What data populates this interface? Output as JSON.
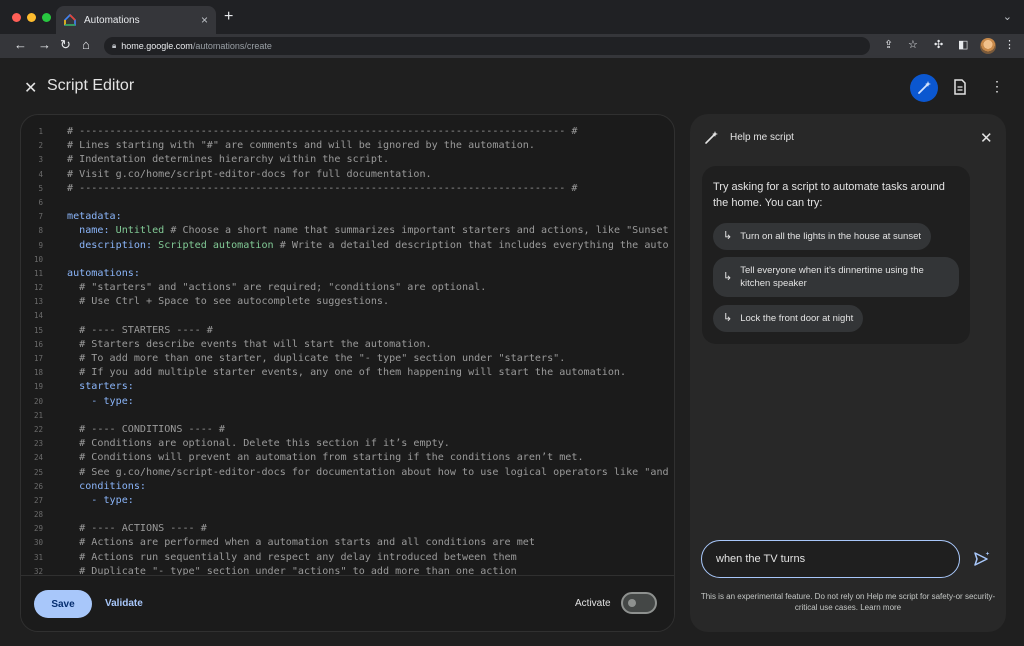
{
  "browser": {
    "tab_title": "Automations",
    "tab_close": "×",
    "new_tab": "+",
    "url_host": "home.google.com",
    "url_path": "/automations/create"
  },
  "header": {
    "title": "Script Editor"
  },
  "editor": {
    "lines": [
      {
        "n": "1",
        "segments": [
          {
            "t": "# -------------------------------------------------------------------------------- #",
            "c": "comment"
          }
        ]
      },
      {
        "n": "2",
        "segments": [
          {
            "t": "# Lines starting with \"#\" are comments and will be ignored by the automation.",
            "c": "comment"
          }
        ]
      },
      {
        "n": "3",
        "segments": [
          {
            "t": "# Indentation determines hierarchy within the script.",
            "c": "comment"
          }
        ]
      },
      {
        "n": "4",
        "segments": [
          {
            "t": "# Visit g.co/home/script-editor-docs for full documentation.",
            "c": "comment"
          }
        ]
      },
      {
        "n": "5",
        "segments": [
          {
            "t": "# -------------------------------------------------------------------------------- #",
            "c": "comment"
          }
        ]
      },
      {
        "n": "6",
        "segments": []
      },
      {
        "n": "7",
        "segments": [
          {
            "t": "metadata:",
            "c": "key"
          }
        ]
      },
      {
        "n": "8",
        "segments": [
          {
            "t": "  name: ",
            "c": "key"
          },
          {
            "t": "Untitled",
            "c": "val"
          },
          {
            "t": " # Choose a short name that summarizes important starters and actions, like \"Sunset",
            "c": "comment"
          }
        ]
      },
      {
        "n": "9",
        "segments": [
          {
            "t": "  description: ",
            "c": "key"
          },
          {
            "t": "Scripted automation",
            "c": "val"
          },
          {
            "t": " # Write a detailed description that includes everything the auto",
            "c": "comment"
          }
        ]
      },
      {
        "n": "10",
        "segments": []
      },
      {
        "n": "11",
        "segments": [
          {
            "t": "automations:",
            "c": "key"
          }
        ]
      },
      {
        "n": "12",
        "segments": [
          {
            "t": "  # \"starters\" and \"actions\" are required; \"conditions\" are optional.",
            "c": "comment"
          }
        ]
      },
      {
        "n": "13",
        "segments": [
          {
            "t": "  # Use Ctrl + Space to see autocomplete suggestions.",
            "c": "comment"
          }
        ]
      },
      {
        "n": "14",
        "segments": []
      },
      {
        "n": "15",
        "segments": [
          {
            "t": "  # ---- STARTERS ---- #",
            "c": "comment"
          }
        ]
      },
      {
        "n": "16",
        "segments": [
          {
            "t": "  # Starters describe events that will start the automation.",
            "c": "comment"
          }
        ]
      },
      {
        "n": "17",
        "segments": [
          {
            "t": "  # To add more than one starter, duplicate the \"- type\" section under \"starters\".",
            "c": "comment"
          }
        ]
      },
      {
        "n": "18",
        "segments": [
          {
            "t": "  # If you add multiple starter events, any one of them happening will start the automation.",
            "c": "comment"
          }
        ]
      },
      {
        "n": "19",
        "segments": [
          {
            "t": "  starters:",
            "c": "key"
          }
        ]
      },
      {
        "n": "20",
        "segments": [
          {
            "t": "    - type:",
            "c": "key"
          }
        ]
      },
      {
        "n": "21",
        "segments": []
      },
      {
        "n": "22",
        "segments": [
          {
            "t": "  # ---- CONDITIONS ---- #",
            "c": "comment"
          }
        ]
      },
      {
        "n": "23",
        "segments": [
          {
            "t": "  # Conditions are optional. Delete this section if it’s empty.",
            "c": "comment"
          }
        ]
      },
      {
        "n": "24",
        "segments": [
          {
            "t": "  # Conditions will prevent an automation from starting if the conditions aren’t met.",
            "c": "comment"
          }
        ]
      },
      {
        "n": "25",
        "segments": [
          {
            "t": "  # See g.co/home/script-editor-docs for documentation about how to use logical operators like \"and",
            "c": "comment"
          }
        ]
      },
      {
        "n": "26",
        "segments": [
          {
            "t": "  conditions:",
            "c": "key"
          }
        ]
      },
      {
        "n": "27",
        "segments": [
          {
            "t": "    - type:",
            "c": "key"
          }
        ]
      },
      {
        "n": "28",
        "segments": []
      },
      {
        "n": "29",
        "segments": [
          {
            "t": "  # ---- ACTIONS ---- #",
            "c": "comment"
          }
        ]
      },
      {
        "n": "30",
        "segments": [
          {
            "t": "  # Actions are performed when a automation starts and all conditions are met",
            "c": "comment"
          }
        ]
      },
      {
        "n": "31",
        "segments": [
          {
            "t": "  # Actions run sequentially and respect any delay introduced between them",
            "c": "comment"
          }
        ]
      },
      {
        "n": "32",
        "segments": [
          {
            "t": "  # Duplicate \"- type\" section under \"actions\" to add more than one action",
            "c": "comment"
          }
        ]
      }
    ],
    "save_label": "Save",
    "validate_label": "Validate",
    "activate_label": "Activate",
    "activate_on": false
  },
  "help_panel": {
    "title": "Help me script",
    "intro": "Try asking for a script to automate tasks around the home. You can try:",
    "suggestions": [
      "Turn on all the lights in the house at sunset",
      "Tell everyone when it’s dinnertime using the kitchen speaker",
      "Lock the front door at night"
    ],
    "input_value": "when the TV turns",
    "disclaimer": "This is an experimental feature. Do not rely on Help me script for safety-or security-critical use cases. Learn more"
  },
  "colors": {
    "accent": "#a8c7fa",
    "primary_button": "#0b57d0",
    "comment": "#9a9a9a",
    "key": "#8ab4f8",
    "value": "#81c995"
  },
  "icons": [
    "close-icon",
    "magic-wand-icon",
    "document-icon",
    "more-vert-icon",
    "send-icon",
    "suggestion-arrow-icon"
  ]
}
